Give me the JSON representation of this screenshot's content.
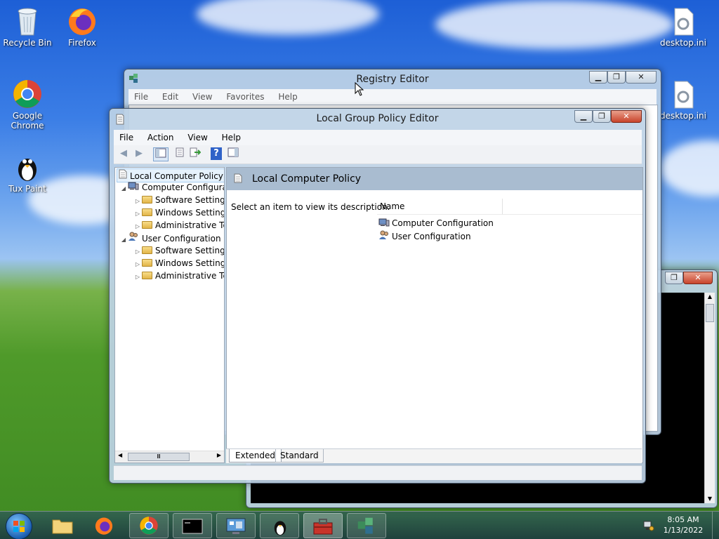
{
  "desktop": {
    "icons": [
      {
        "label": "Recycle Bin"
      },
      {
        "label": "Firefox"
      },
      {
        "label": "Google Chrome"
      },
      {
        "label": "Tux Paint"
      },
      {
        "label": "desktop.ini"
      },
      {
        "label": "desktop.ini"
      }
    ]
  },
  "registry_editor": {
    "title": "Registry Editor",
    "menu": [
      "File",
      "Edit",
      "View",
      "Favorites",
      "Help"
    ]
  },
  "gpedit": {
    "title": "Local Group Policy Editor",
    "menu": [
      "File",
      "Action",
      "View",
      "Help"
    ],
    "tree": {
      "root": "Local Computer Policy",
      "computer_config": "Computer Configura",
      "user_config": "User Configuration",
      "children": [
        "Software Settings",
        "Windows Setting",
        "Administrative Te"
      ],
      "scroll_grip": "Ⅲ"
    },
    "detail": {
      "header": "Local Computer Policy",
      "description": "Select an item to view its description.",
      "column_name": "Name",
      "items": [
        "Computer Configuration",
        "User Configuration"
      ]
    },
    "tabs": [
      "Extended",
      "Standard"
    ]
  },
  "taskbar": {
    "time": "8:05 AM",
    "date": "1/13/2022"
  },
  "colors": {
    "detail_header_bg": "#a9bcd0",
    "selection": "#cde8ff",
    "help_icon": "#2f62c8"
  }
}
